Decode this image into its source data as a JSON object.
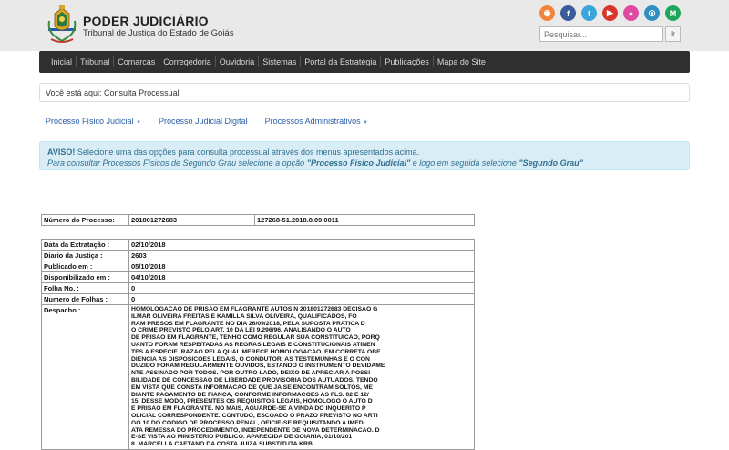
{
  "header": {
    "title": "PODER JUDICIÁRIO",
    "subtitle": "Tribunal de Justiça do Estado de Goiás",
    "search_placeholder": "Pesquisar...",
    "search_button": "Ir",
    "social": [
      {
        "icon": "rss-icon",
        "glyph": "◉",
        "color": "#f0843b"
      },
      {
        "icon": "facebook-icon",
        "glyph": "f",
        "color": "#3b5b9a"
      },
      {
        "icon": "twitter-icon",
        "glyph": "t",
        "color": "#3aa5dc"
      },
      {
        "icon": "youtube-icon",
        "glyph": "▶",
        "color": "#d9362b"
      },
      {
        "icon": "flickr-icon",
        "glyph": "●",
        "color": "#de4aa0"
      },
      {
        "icon": "instagram-icon",
        "glyph": "◎",
        "color": "#2f8fc1"
      },
      {
        "icon": "medium-icon",
        "glyph": "M",
        "color": "#1ea65a"
      }
    ]
  },
  "nav": [
    "Inicial",
    "Tribunal",
    "Comarcas",
    "Corregedoria",
    "Ouvidoria",
    "Sistemas",
    "Portal da Estratégia",
    "Publicações",
    "Mapa do Site"
  ],
  "breadcrumb": "Você está aqui: Consulta Processual",
  "subnav": {
    "fisico": "Processo Físico Judicial",
    "digital": "Processo Judicial Digital",
    "admin": "Processos Administrativos"
  },
  "alert": {
    "strong": "AVISO!",
    "line1": "Selecione uma das opções para consulta processual através dos menus apresentados acima.",
    "line2_a": "Para consultar Processos Físicos de Segundo Grau selecione a opção",
    "line2_b": "\"Processo Físico Judicial\"",
    "line2_c": "e logo em seguida selecione",
    "line2_d": "\"Segundo Grau\""
  },
  "processo": {
    "label": "Número do Processo:",
    "numero": "201801272683",
    "numero_unico": "127268-51.2018.8.09.0011"
  },
  "detalhes": [
    {
      "label": "Data da Extratação :",
      "value": "02/10/2018"
    },
    {
      "label": "Diario da Justiça :",
      "value": "2603"
    },
    {
      "label": "Publicado em :",
      "value": "05/10/2018"
    },
    {
      "label": "Disponibilizado em :",
      "value": "04/10/2018"
    },
    {
      "label": "Folha No. :",
      "value": "0"
    },
    {
      "label": "Numero de Folhas :",
      "value": "0"
    }
  ],
  "despacho": {
    "label": "Despacho :",
    "text": "HOMOLOGACAO DE PRISAO EM FLAGRANTE AUTOS N 201801272683 DECISAO G\nILMAR OLIVEIRA FREITAS E KAMILLA SILVA OLIVEIRA, QUALIFICADOS, FO\nRAM PRESOS EM FLAGRANTE NO DIA 26/09/2018, PELA SUPOSTA PRATICA D\nO CRIME PREVISTO PELO ART. 10 DA LEI 9.296/96. ANALISANDO O AUTO\nDE PRISAO EM FLAGRANTE, TENHO COMO REGULAR SUA CONSTITUICAO, PORQ\nUANTO FORAM RESPEITADAS AS REGRAS LEGAIS E CONSTITUCIONAIS ATINEN\nTES A ESPECIE. RAZAO PELA QUAL MERECE HOMOLOGACAO. EM CORRETA OBE\nDIENCIA AS DISPOSICOES LEGAIS, O CONDUTOR, AS TESTEMUNHAS E O CON\nDUZIDO FORAM REGULARMENTE OUVIDOS, ESTANDO O INSTRUMENTO DEVIDAME\nNTE ASSINADO POR TODOS. POR OUTRO LADO, DEIXO DE APRECIAR A POSSI\nBILIDADE DE CONCESSAO DE LIBERDADE PROVISORIA DOS AUTUADOS, TENDO\nEM VISTA QUE CONSTA INFORMACAO DE QUE JA SE ENCONTRAM SOLTOS, ME\nDIANTE PAGAMENTO DE FIANCA, CONFORME INFORMACOES AS FLS. 02 E 12/\n15. DESSE MODO, PRESENTES OS REQUISITOS LEGAIS, HOMOLOGO O AUTO D\nE PRISAO EM FLAGRANTE. NO MAIS, AGUARDE-SE A VINDA DO INQUERITO P\nOLICIAL CORRESPONDENTE. CONTUDO, ESCOADO O PRAZO PREVISTO NO ARTI\nGO 10 DO CODIGO DE PROCESSO PENAL, OFICIE-SE REQUISITANDO A IMEDI\nATA REMESSA DO PROCEDIMENTO, INDEPENDENTE DE NOVA DETERMINACAO. D\nE-SE VISTA AO MINISTERIO PUBLICO. APARECIDA DE GOIANIA, 01/10/201\n8. MARCELLA CAETANO DA COSTA JUIZA SUBSTITUTA KRB"
  }
}
